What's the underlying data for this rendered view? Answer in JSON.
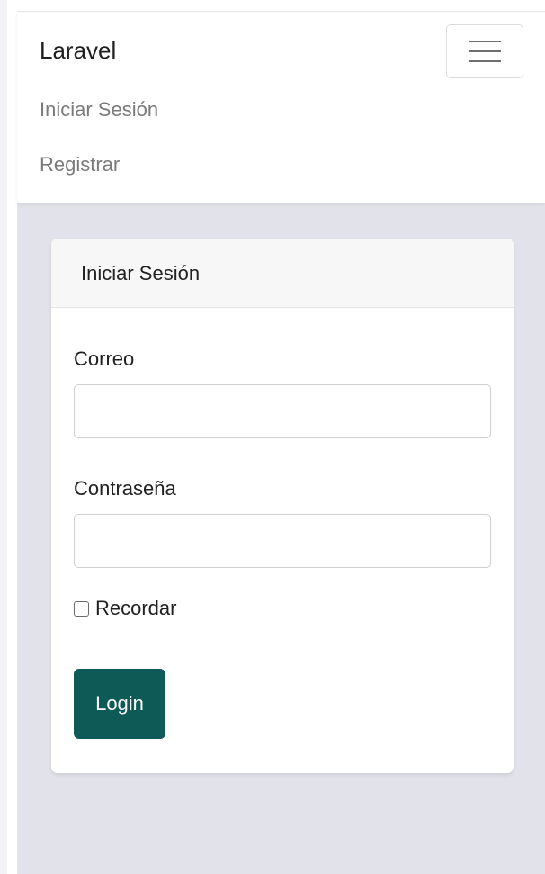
{
  "navbar": {
    "brand": "Laravel",
    "links": [
      "Iniciar Sesión",
      "Registrar"
    ],
    "toggler_icon": "hamburger-menu-icon"
  },
  "card": {
    "title": "Iniciar Sesión",
    "email_label": "Correo",
    "email_value": "",
    "password_label": "Contraseña",
    "password_value": "",
    "remember_label": "Recordar",
    "remember_checked": false,
    "login_label": "Login"
  },
  "colors": {
    "accent": "#0d5a56",
    "page_background": "#e2e3ea",
    "nav_link": "#7a7a7a"
  }
}
